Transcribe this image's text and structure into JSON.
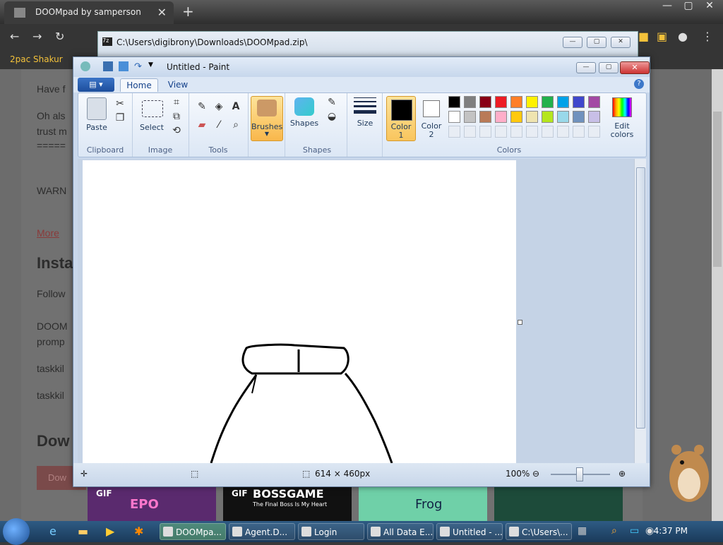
{
  "browser": {
    "tab_title": "DOOMpad by samperson",
    "tab_close": "✕",
    "new_tab": "+",
    "bookmark": "2pac Shakur",
    "win_controls": [
      "—",
      "▢",
      "✕"
    ]
  },
  "webpage": {
    "lines": [
      "Have f",
      "Oh als",
      "trust m",
      "=====",
      "WARN",
      "More",
      "Insta",
      "Follow",
      "DOOM",
      "promp",
      "taskkil",
      "taskkil",
      "Dow",
      "Dow"
    ],
    "thumbs": [
      {
        "badge": "GIF",
        "caption": "EPO"
      },
      {
        "badge": "GIF",
        "caption": "BOSSGAME",
        "sub": "The Final Boss Is My Heart"
      },
      {
        "badge": "",
        "caption": "Frog"
      },
      {
        "badge": "",
        "caption": ""
      }
    ]
  },
  "zip_window": {
    "title": "C:\\Users\\digibrony\\Downloads\\DOOMpad.zip\\"
  },
  "paint": {
    "title": "Untitled - Paint",
    "tabs": {
      "home": "Home",
      "view": "View"
    },
    "help": "?",
    "groups": {
      "clipboard": {
        "label": "Clipboard",
        "paste": "Paste"
      },
      "image": {
        "label": "Image",
        "select": "Select"
      },
      "tools": {
        "label": "Tools"
      },
      "brushes": {
        "label": "Brushes"
      },
      "shapes": {
        "label": "Shapes",
        "button": "Shapes"
      },
      "size": {
        "label": "Size"
      },
      "colors": {
        "label": "Colors",
        "color1_line1": "Color",
        "color1_line2": "1",
        "color2_line1": "Color",
        "color2_line2": "2",
        "edit_line1": "Edit",
        "edit_line2": "colors"
      }
    },
    "palette": [
      "#000000",
      "#7f7f7f",
      "#880015",
      "#ed1c24",
      "#ff7f27",
      "#fff200",
      "#22b14c",
      "#00a2e8",
      "#3f48cc",
      "#a349a4",
      "#ffffff",
      "#c3c3c3",
      "#b97a57",
      "#ffaec9",
      "#ffc90e",
      "#efe4b0",
      "#b5e61d",
      "#99d9ea",
      "#7092be",
      "#c8bfe7"
    ],
    "status": {
      "size": "614 × 460px",
      "zoom": "100%"
    }
  },
  "taskbar": {
    "buttons": [
      "DOOMpa...",
      "Agent.D...",
      "Login",
      "All Data E...",
      "Untitled - ...",
      "C:\\Users\\..."
    ],
    "clock": "4:37 PM"
  }
}
